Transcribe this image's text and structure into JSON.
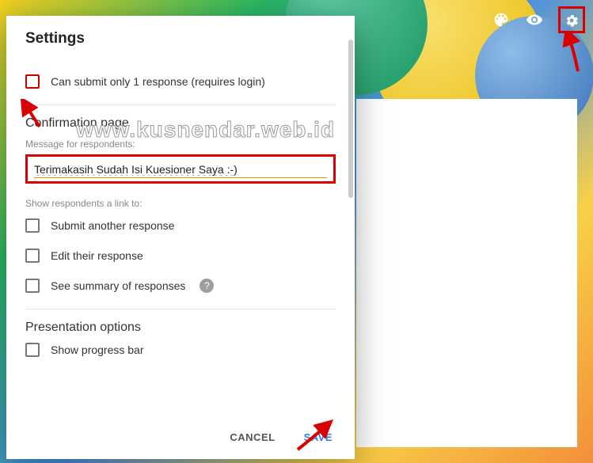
{
  "dialog": {
    "title": "Settings",
    "canSubmitOnce": "Can submit only 1 response (requires login)",
    "confirmation": {
      "title": "Confirmation page",
      "messageLabel": "Message for respondents:",
      "messageValue": "Terimakasih Sudah Isi Kuesioner Saya :-)"
    },
    "showLinkLabel": "Show respondents a link to:",
    "submitAnother": "Submit another response",
    "editResponse": "Edit their response",
    "seeSummary": "See summary of responses",
    "presentation": {
      "title": "Presentation options",
      "showProgress": "Show progress bar"
    },
    "actions": {
      "cancel": "CANCEL",
      "save": "SAVE"
    }
  },
  "watermark": "www.kusnendar.web.id",
  "colors": {
    "highlight": "#d80000",
    "primary": "#3b78e7"
  }
}
